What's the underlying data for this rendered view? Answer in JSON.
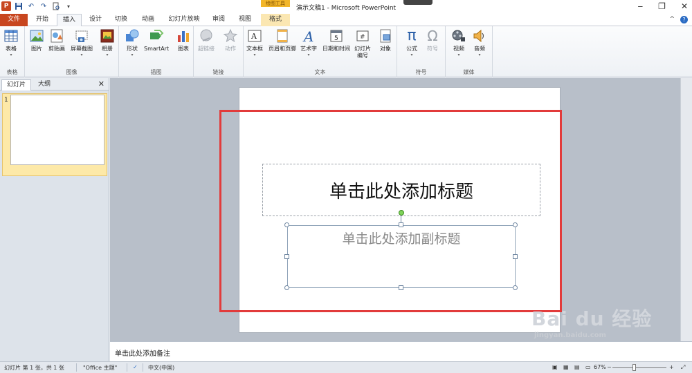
{
  "titlebar": {
    "app_logo": "P",
    "contextual_tools": "绘图工具",
    "window_title": "演示文稿1 - Microsoft PowerPoint",
    "qat_icons": [
      "save-icon",
      "undo-icon",
      "redo-icon",
      "print-preview-icon",
      "customize-dropdown-icon"
    ],
    "window_controls": {
      "minimize": "‒",
      "restore": "❐",
      "close": "✕"
    }
  },
  "tabs": {
    "file": "文件",
    "home": "开始",
    "insert": "插入",
    "design": "设计",
    "transitions": "切换",
    "animations": "动画",
    "slideshow": "幻灯片放映",
    "review": "审阅",
    "view": "视图",
    "format": "格式",
    "collapse": "^",
    "help": "?"
  },
  "ribbon": {
    "groups": {
      "tables": "表格",
      "images": "图像",
      "illustrations": "插图",
      "links": "链接",
      "text": "文本",
      "symbols": "符号",
      "media": "媒体"
    },
    "buttons": {
      "table": "表格",
      "picture": "图片",
      "clipart": "剪贴画",
      "screenshot": "屏幕截图",
      "album": "相册",
      "shapes": "形状",
      "smartart": "SmartArt",
      "chart": "图表",
      "hyperlink": "超链接",
      "action": "动作",
      "textbox": "文本框",
      "header_footer": "页眉和页脚",
      "wordart": "艺术字",
      "datetime": "日期和时间",
      "slide_number_line1": "幻灯片",
      "slide_number_line2": "编号",
      "object": "对象",
      "equation": "公式",
      "symbol": "符号",
      "video": "视频",
      "audio": "音频"
    }
  },
  "leftpane": {
    "tab_slides": "幻灯片",
    "tab_outline": "大纲",
    "close": "✕",
    "slide_number": "1"
  },
  "slide": {
    "title_placeholder": "单击此处添加标题",
    "subtitle_placeholder": "单击此处添加副标题"
  },
  "notes": {
    "placeholder": "单击此处添加备注"
  },
  "statusbar": {
    "slide_info": "幻灯片 第 1 张，共 1 张",
    "theme": "\"Office 主题\"",
    "language": "中文(中国)",
    "zoom": "67%",
    "zoom_minus": "−",
    "zoom_plus": "+"
  },
  "watermark": {
    "brand": "Bai  du 经验",
    "url": "jingyan.baidu.com"
  },
  "colors": {
    "file_tab": "#c8461f",
    "highlight_box": "#e23b3b",
    "contextual_tab": "#f2b62a"
  }
}
